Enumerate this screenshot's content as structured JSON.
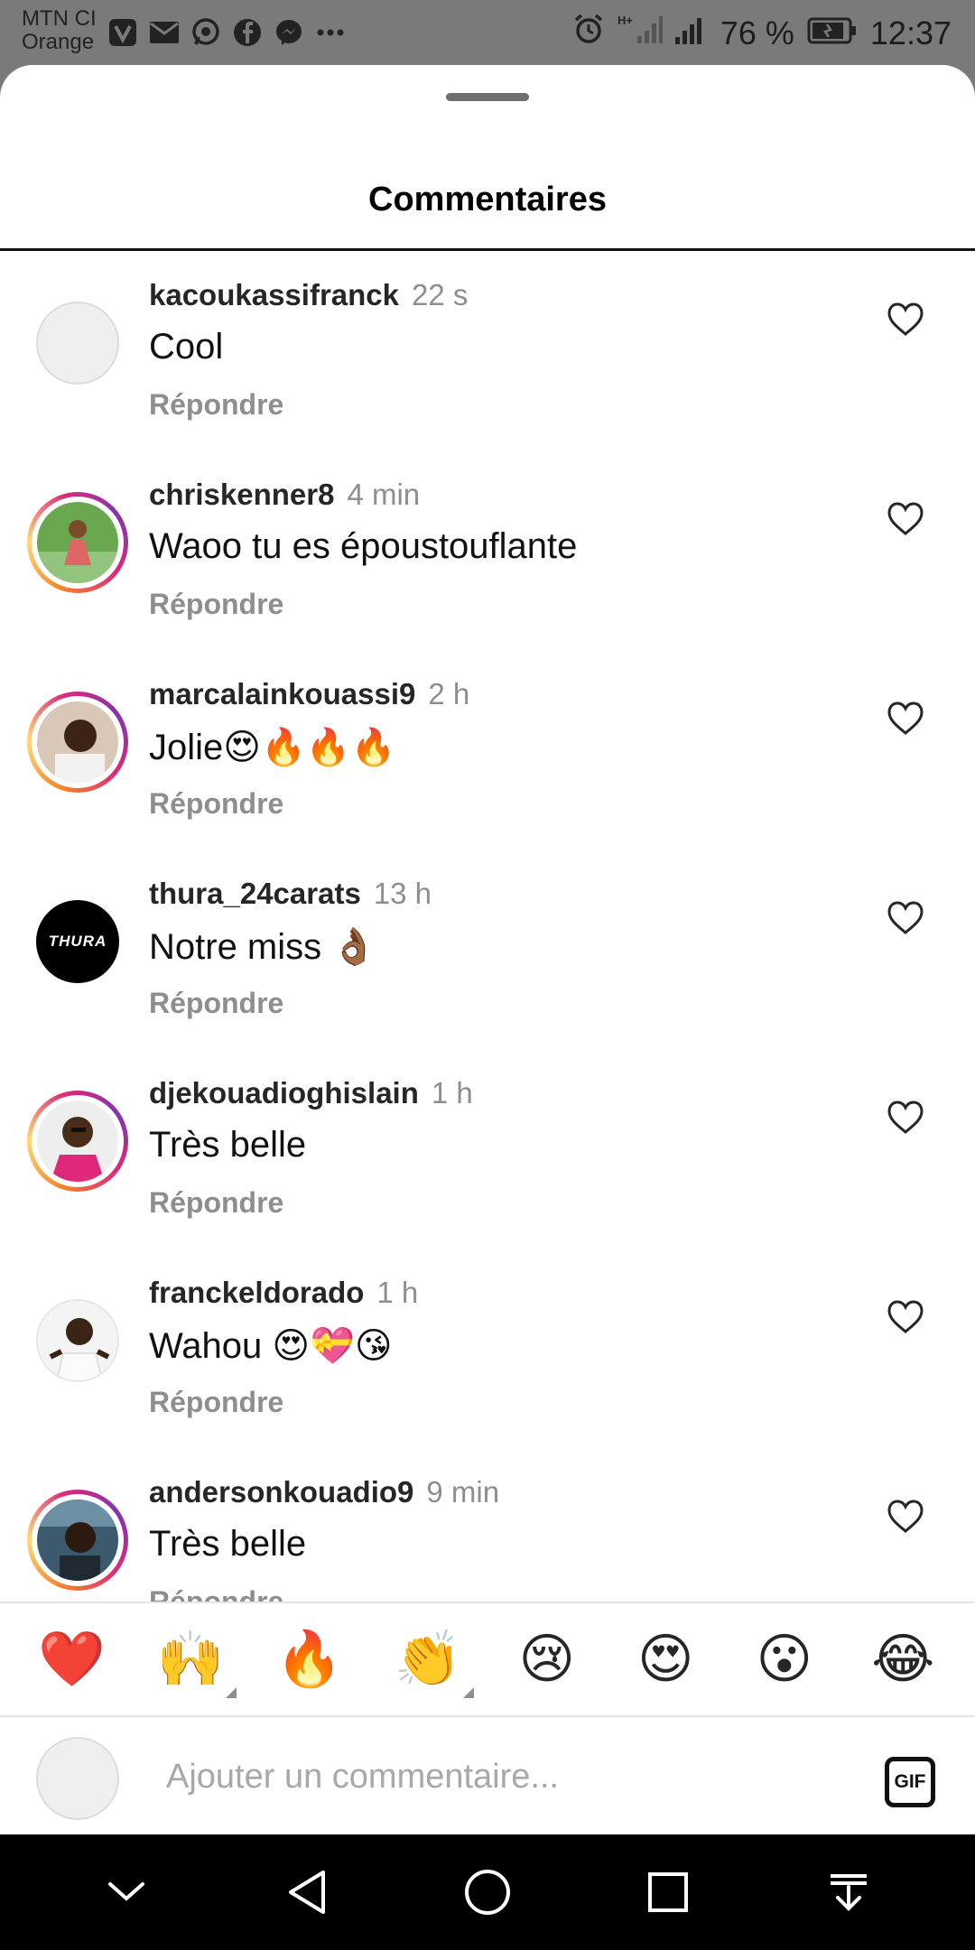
{
  "status_bar": {
    "carrier_line1": "MTN CI",
    "carrier_line2": "Orange",
    "battery": "76 %",
    "time": "12:37"
  },
  "sheet": {
    "title": "Commentaires"
  },
  "comments": [
    {
      "username": "kacoukassifranck",
      "time": "22 s",
      "text": "Cool",
      "reply": "Répondre"
    },
    {
      "username": "chriskenner8",
      "time": "4 min",
      "text": "Waoo tu es époustouflante",
      "reply": "Répondre"
    },
    {
      "username": "marcalainkouassi9",
      "time": "2 h",
      "text": "Jolie😍🔥🔥🔥",
      "reply": "Répondre"
    },
    {
      "username": "thura_24carats",
      "time": "13 h",
      "text": "Notre miss 👌🏾",
      "reply": "Répondre",
      "avatar_text": "THURA"
    },
    {
      "username": "djekouadioghislain",
      "time": "1 h",
      "text": "Très belle",
      "reply": "Répondre"
    },
    {
      "username": "franckeldorado",
      "time": "1 h",
      "text": "Wahou 😍💝😘",
      "reply": "Répondre"
    },
    {
      "username": "andersonkouadio9",
      "time": "9 min",
      "text": "Très belle",
      "reply": "Répondre"
    }
  ],
  "reactions": [
    "❤️",
    "🙌",
    "🔥",
    "👏",
    "😢",
    "😍",
    "😮",
    "😂"
  ],
  "comment_input": {
    "placeholder": "Ajouter un commentaire...",
    "gif_label": "GIF"
  },
  "icons": {
    "like": "heart-outline-icon",
    "nav": [
      "chevron-down-icon",
      "back-triangle-icon",
      "home-circle-icon",
      "recents-square-icon",
      "notification-pull-icon"
    ]
  },
  "colors": {
    "story_ring": "#dd2a7b",
    "secondary_text": "#8e8e8e",
    "heart_reaction": "#e0245e"
  }
}
